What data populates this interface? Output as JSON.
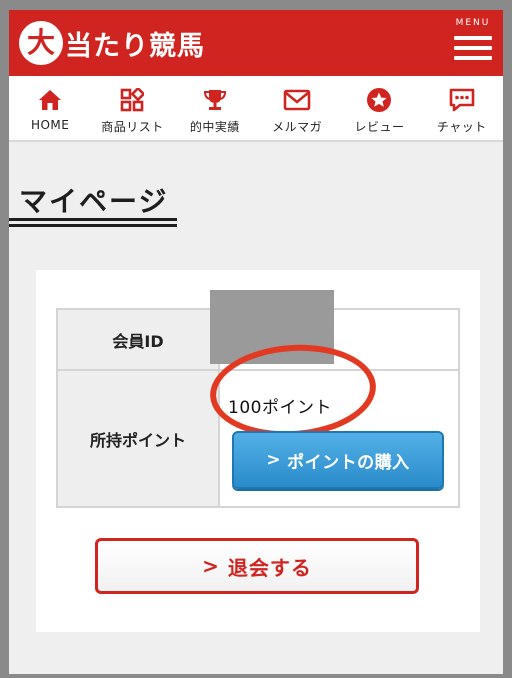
{
  "header": {
    "logo_mark": "大",
    "logo_text": "当たり競馬",
    "menu_label": "MENU"
  },
  "nav": {
    "items": [
      {
        "label": "HOME",
        "icon": "home-icon"
      },
      {
        "label": "商品リスト",
        "icon": "grid-icon"
      },
      {
        "label": "的中実績",
        "icon": "trophy-icon"
      },
      {
        "label": "メルマガ",
        "icon": "mail-icon"
      },
      {
        "label": "レビュー",
        "icon": "star-icon"
      },
      {
        "label": "チャット",
        "icon": "chat-icon"
      }
    ]
  },
  "page": {
    "title": "マイページ"
  },
  "account": {
    "member_id_label": "会員ID",
    "points_label": "所持ポイント",
    "points_value": "100ポイント",
    "buy_points_label": "ポイントの購入"
  },
  "withdraw": {
    "label": "退会する"
  },
  "colors": {
    "brand_red": "#d02420",
    "button_blue": "#2a8bcb",
    "annotation_red": "#e23a22"
  }
}
